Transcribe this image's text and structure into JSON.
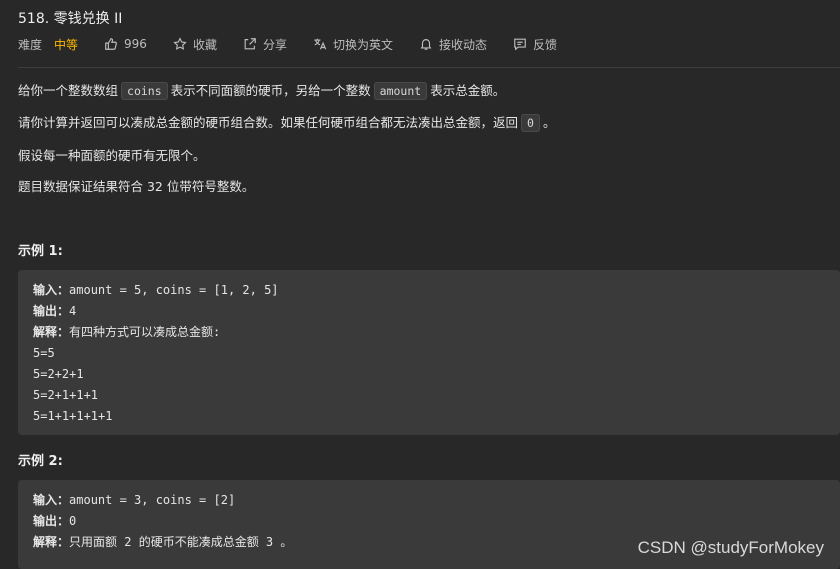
{
  "problem": {
    "title": "518. 零钱兑换 II"
  },
  "toolbar": {
    "difficulty_label": "难度",
    "difficulty_value": "中等",
    "like_count": "996",
    "favorite_label": "收藏",
    "share_label": "分享",
    "translate_label": "切换为英文",
    "notify_label": "接收动态",
    "feedback_label": "反馈",
    "difficulty_color": "#ffb800"
  },
  "description": {
    "p1_a": "给你一个整数数组",
    "p1_code1": "coins",
    "p1_b": "表示不同面额的硬币，另给一个整数",
    "p1_code2": "amount",
    "p1_c": "表示总金额。",
    "p2_a": "请你计算并返回可以凑成总金额的硬币组合数。如果任何硬币组合都无法凑出总金额，返回",
    "p2_code": "0",
    "p2_b": "。",
    "p3": "假设每一种面额的硬币有无限个。",
    "p4": "题目数据保证结果符合 32 位带符号整数。"
  },
  "examples": [
    {
      "heading": "示例 1:",
      "input_label": "输入：",
      "input_value": "amount = 5, coins = [1, 2, 5]",
      "output_label": "输出：",
      "output_value": "4",
      "explain_label": "解释：",
      "explain_value": "有四种方式可以凑成总金额:",
      "lines": [
        "5=5",
        "5=2+2+1",
        "5=2+1+1+1",
        "5=1+1+1+1+1"
      ]
    },
    {
      "heading": "示例 2:",
      "input_label": "输入：",
      "input_value": "amount = 3, coins = [2]",
      "output_label": "输出：",
      "output_value": "0",
      "explain_label": "解释：",
      "explain_value": "只用面额 2 的硬币不能凑成总金额 3 。"
    }
  ],
  "watermark": "CSDN @studyForMokey"
}
